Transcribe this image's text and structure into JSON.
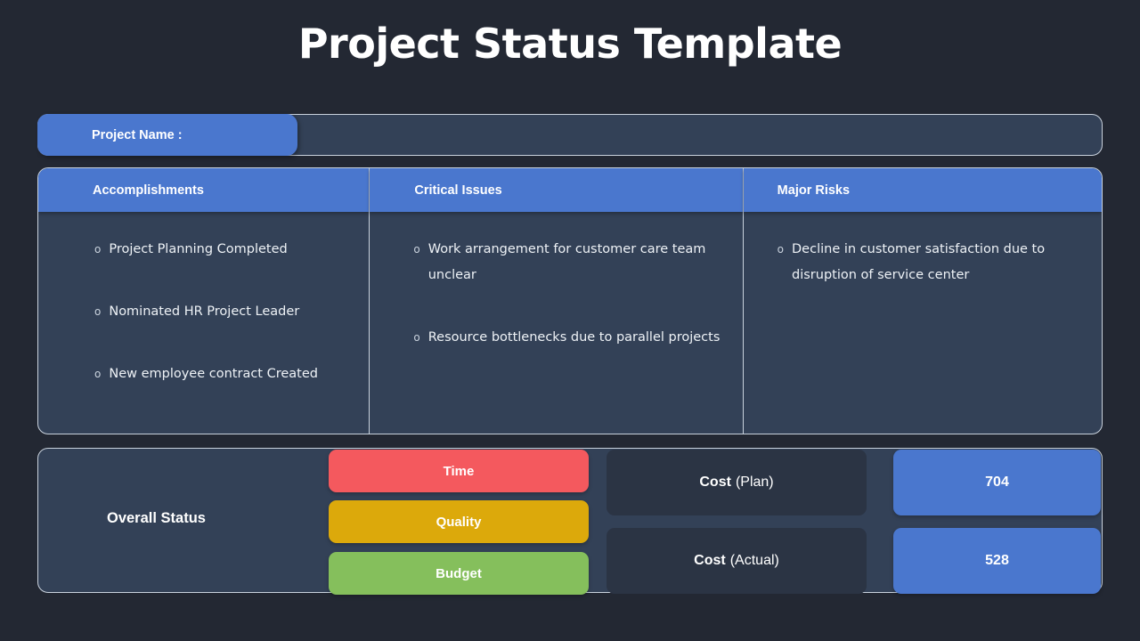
{
  "slide": {
    "title": "Project Status Template"
  },
  "project_name": {
    "label": "Project Name :",
    "value": ""
  },
  "columns": [
    {
      "header": "Accomplishments",
      "bullet_marker": "o",
      "items": [
        "Project Planning Completed",
        "Nominated HR Project Leader",
        "New employee contract Created"
      ]
    },
    {
      "header": "Critical Issues",
      "bullet_marker": "o",
      "items": [
        "Work arrangement for customer care team unclear",
        "Resource bottlenecks due to parallel projects"
      ]
    },
    {
      "header": "Major Risks",
      "bullet_marker": "o",
      "items": [
        "Decline in customer satisfaction due to disruption of service center"
      ]
    }
  ],
  "status": {
    "label": "Overall Status",
    "chips": [
      {
        "label": "Time",
        "color": "#f4595e"
      },
      {
        "label": "Quality",
        "color": "#dca90b"
      },
      {
        "label": "Budget",
        "color": "#85bf5c"
      }
    ],
    "cost_rows": [
      {
        "label_strong": "Cost",
        "label_light": "(Plan)",
        "value": "704"
      },
      {
        "label_strong": "Cost",
        "label_light": "(Actual)",
        "value": "528"
      }
    ]
  },
  "theme": {
    "background": "#232833",
    "panel": "#334157",
    "panel_border": "#c9d2dd",
    "accent_blue": "#4a77ce",
    "cost_box": "#2b3444"
  }
}
